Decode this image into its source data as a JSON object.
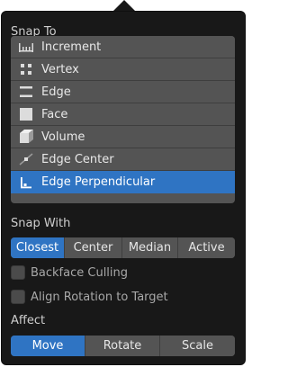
{
  "snap_to": {
    "label": "Snap To",
    "items": [
      {
        "label": "Increment",
        "icon": "increment-icon",
        "selected": false
      },
      {
        "label": "Vertex",
        "icon": "vertex-icon",
        "selected": false
      },
      {
        "label": "Edge",
        "icon": "edge-icon",
        "selected": false
      },
      {
        "label": "Face",
        "icon": "face-icon",
        "selected": false
      },
      {
        "label": "Volume",
        "icon": "volume-icon",
        "selected": false
      },
      {
        "label": "Edge Center",
        "icon": "edge-center-icon",
        "selected": false
      },
      {
        "label": "Edge Perpendicular",
        "icon": "edge-perpendicular-icon",
        "selected": true
      }
    ]
  },
  "snap_with": {
    "label": "Snap With",
    "options": [
      "Closest",
      "Center",
      "Median",
      "Active"
    ],
    "active": "Closest"
  },
  "backface_culling": {
    "label": "Backface Culling",
    "checked": false
  },
  "align_rotation": {
    "label": "Align Rotation to Target",
    "checked": false
  },
  "affect": {
    "label": "Affect",
    "options": [
      "Move",
      "Rotate",
      "Scale"
    ],
    "active": "Move"
  },
  "colors": {
    "accent": "#2f74c3",
    "panel": "#181818",
    "item": "#545454"
  }
}
